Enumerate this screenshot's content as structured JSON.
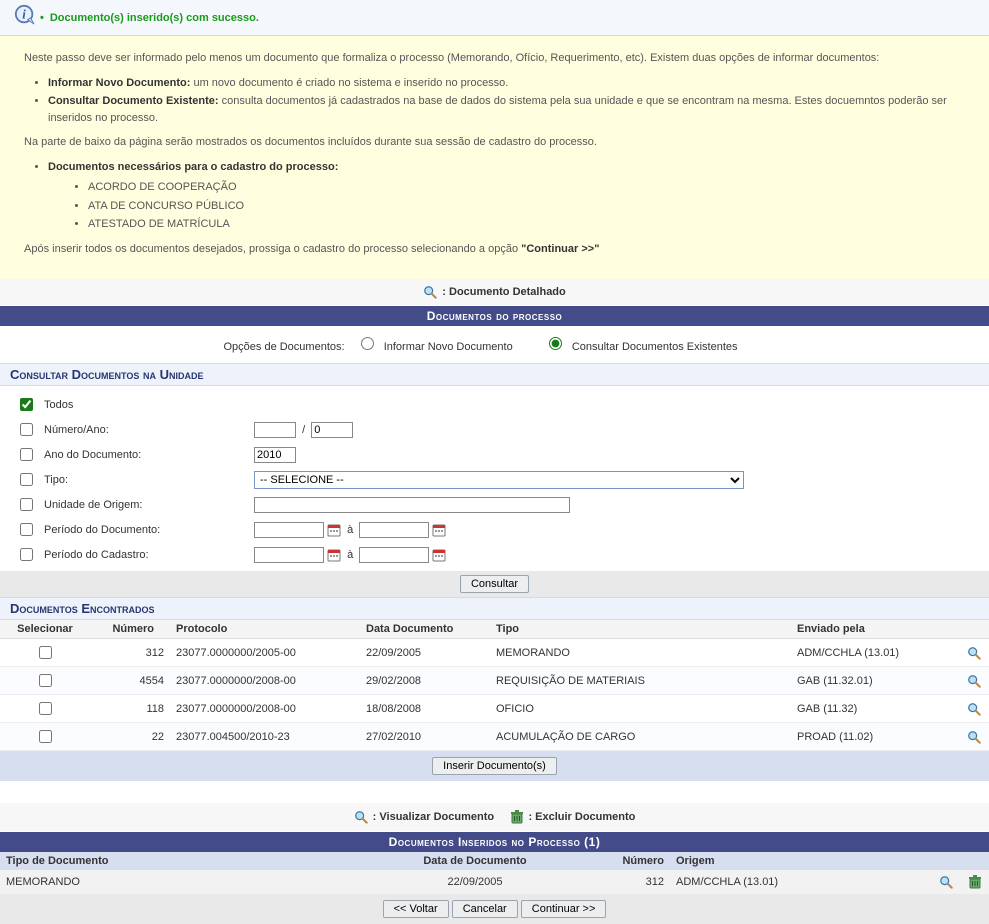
{
  "success_message": "Documento(s) inserido(s) com sucesso.",
  "instructions": {
    "intro": "Neste passo deve ser informado pelo menos um documento que formaliza o processo (Memorando, Ofício, Requerimento, etc). Existem duas opções de informar documentos:",
    "opt1_label": "Informar Novo Documento:",
    "opt1_text": " um novo documento é criado no sistema e inserido no processo.",
    "opt2_label": "Consultar Documento Existente:",
    "opt2_text": " consulta documentos já cadastrados na base de dados do sistema pela sua unidade e que se encontram na mesma. Estes docuemntos poderão ser inseridos no processo.",
    "middle": "Na parte de baixo da página serão mostrados os documentos incluídos durante sua sessão de cadastro do processo.",
    "needed_label": "Documentos necessários para o cadastro do processo:",
    "needed_items": [
      "ACORDO DE COOPERAÇÃO",
      "ATA DE CONCURSO PÚBLICO",
      "ATESTADO DE MATRÍCULA"
    ],
    "outro_a": "Após inserir todos os documentos desejados, prossiga o cadastro do processo selecionando a opção ",
    "outro_b": "\"Continuar >>\""
  },
  "legend_detail": ": Documento Detalhado",
  "band_docs": "Documentos do processo",
  "options": {
    "label": "Opções de Documentos:",
    "opt_new": "Informar Novo Documento",
    "opt_exist": "Consultar Documentos Existentes"
  },
  "search_section": "Consultar Documentos na Unidade",
  "filters": {
    "all": "Todos",
    "num_ano": "Número/Ano:",
    "num_ano_sep": "/",
    "num_ano_val2": "0",
    "ano_doc": "Ano do Documento:",
    "ano_doc_val": "2010",
    "tipo": "Tipo:",
    "tipo_placeholder": "-- SELECIONE --",
    "unidade": "Unidade de Origem:",
    "periodo_doc": "Período do Documento:",
    "periodo_cad": "Período do Cadastro:",
    "sep_a": "à",
    "consultar_btn": "Consultar"
  },
  "found_section": "Documentos Encontrados",
  "results": {
    "cols": [
      "Selecionar",
      "Número",
      "Protocolo",
      "Data Documento",
      "Tipo",
      "Enviado pela"
    ],
    "rows": [
      {
        "num": "312",
        "proto": "23077.0000000/2005-00",
        "data": "22/09/2005",
        "tipo": "MEMORANDO",
        "env": "ADM/CCHLA (13.01)"
      },
      {
        "num": "4554",
        "proto": "23077.0000000/2008-00",
        "data": "29/02/2008",
        "tipo": "REQUISIÇÃO DE MATERIAIS",
        "env": "GAB (11.32.01)"
      },
      {
        "num": "118",
        "proto": "23077.0000000/2008-00",
        "data": "18/08/2008",
        "tipo": "OFICIO",
        "env": "GAB (11.32)"
      },
      {
        "num": "22",
        "proto": "23077.004500/2010-23",
        "data": "27/02/2010",
        "tipo": "ACUMULAÇÃO DE CARGO",
        "env": "PROAD (11.02)"
      }
    ]
  },
  "insert_btn": "Inserir Documento(s)",
  "legend_view": ": Visualizar Documento",
  "legend_del": ": Excluir Documento",
  "band_inserted": "Documentos Inseridos no Processo (1)",
  "inserted": {
    "cols": [
      "Tipo de Documento",
      "Data de Documento",
      "Número",
      "Origem"
    ],
    "rows": [
      {
        "tipo": "MEMORANDO",
        "data": "22/09/2005",
        "num": "312",
        "orig": "ADM/CCHLA (13.01)"
      }
    ]
  },
  "nav": {
    "voltar": "<< Voltar",
    "cancelar": "Cancelar",
    "continuar": "Continuar >>"
  }
}
